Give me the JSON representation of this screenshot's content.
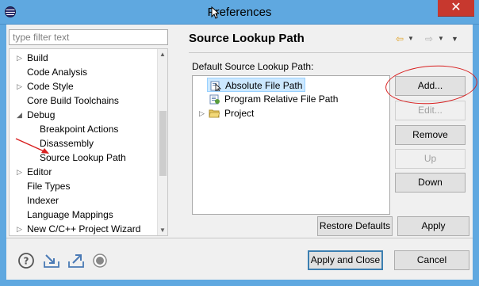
{
  "window": {
    "title": "Preferences",
    "close_glyph": "✕"
  },
  "filter": {
    "placeholder": "type filter text",
    "value": ""
  },
  "tree_left": {
    "items": [
      {
        "label": "Build",
        "expander": "▷"
      },
      {
        "label": "Code Analysis",
        "expander": ""
      },
      {
        "label": "Code Style",
        "expander": "▷"
      },
      {
        "label": "Core Build Toolchains",
        "expander": ""
      },
      {
        "label": "Debug",
        "expander": "◢"
      },
      {
        "label": "Breakpoint Actions",
        "expander": ""
      },
      {
        "label": "Disassembly",
        "expander": ""
      },
      {
        "label": "Source Lookup Path",
        "expander": ""
      },
      {
        "label": "Editor",
        "expander": "▷"
      },
      {
        "label": "File Types",
        "expander": ""
      },
      {
        "label": "Indexer",
        "expander": ""
      },
      {
        "label": "Language Mappings",
        "expander": ""
      },
      {
        "label": "New C/C++ Project Wizard",
        "expander": "▷"
      }
    ]
  },
  "page": {
    "title": "Source Lookup Path",
    "group_label": "Default Source Lookup Path:"
  },
  "tree_right": {
    "items": [
      {
        "label": "Absolute File Path",
        "icon": "absolute-path-icon"
      },
      {
        "label": "Program Relative File Path",
        "icon": "relative-path-icon"
      },
      {
        "label": "Project",
        "icon": "folder-icon",
        "expander": "▷"
      }
    ]
  },
  "buttons": {
    "add": "Add...",
    "edit": "Edit...",
    "remove": "Remove",
    "up": "Up",
    "down": "Down",
    "restore_defaults": "Restore Defaults",
    "apply": "Apply",
    "apply_and_close": "Apply and Close",
    "cancel": "Cancel"
  },
  "colors": {
    "titlebar": "#5fa8e0",
    "close": "#c7382e",
    "annotation": "#d82020",
    "selection": "#cce8ff"
  }
}
